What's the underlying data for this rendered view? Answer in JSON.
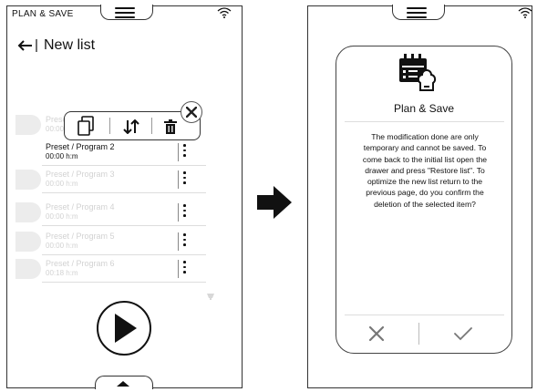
{
  "left_screen": {
    "header_title": "PLAN & SAVE",
    "page_title": "New list",
    "items": [
      {
        "name": "Preset / Program 1",
        "time": "00:00 h:m"
      },
      {
        "name": "Preset / Program 2",
        "time": "00:00 h:m"
      },
      {
        "name": "Preset / Program 3",
        "time": "00:00 h:m"
      },
      {
        "name": "Preset / Program 4",
        "time": "00:00 h:m"
      },
      {
        "name": "Preset / Program 5",
        "time": "00:00 h:m"
      },
      {
        "name": "Preset / Program 6",
        "time": "00:18 h:m"
      }
    ],
    "toolbar": {
      "icons": [
        "copy-icon",
        "sort-icon",
        "trash-icon",
        "close-icon"
      ]
    },
    "play_button_icon": "play-icon"
  },
  "right_screen": {
    "popup_title": "Plan & Save",
    "popup_message": "The modification done are only temporary and cannot be saved. To come back to the initial list open the drawer and press \"Restore list\". To optimize the new list return to the previous page, do you confirm the deletion of the selected item?",
    "cancel_icon": "x-icon",
    "confirm_icon": "check-icon"
  },
  "colors": {
    "border": "#333333",
    "faded_text": "#d2d2d2",
    "accent": "#111111"
  }
}
